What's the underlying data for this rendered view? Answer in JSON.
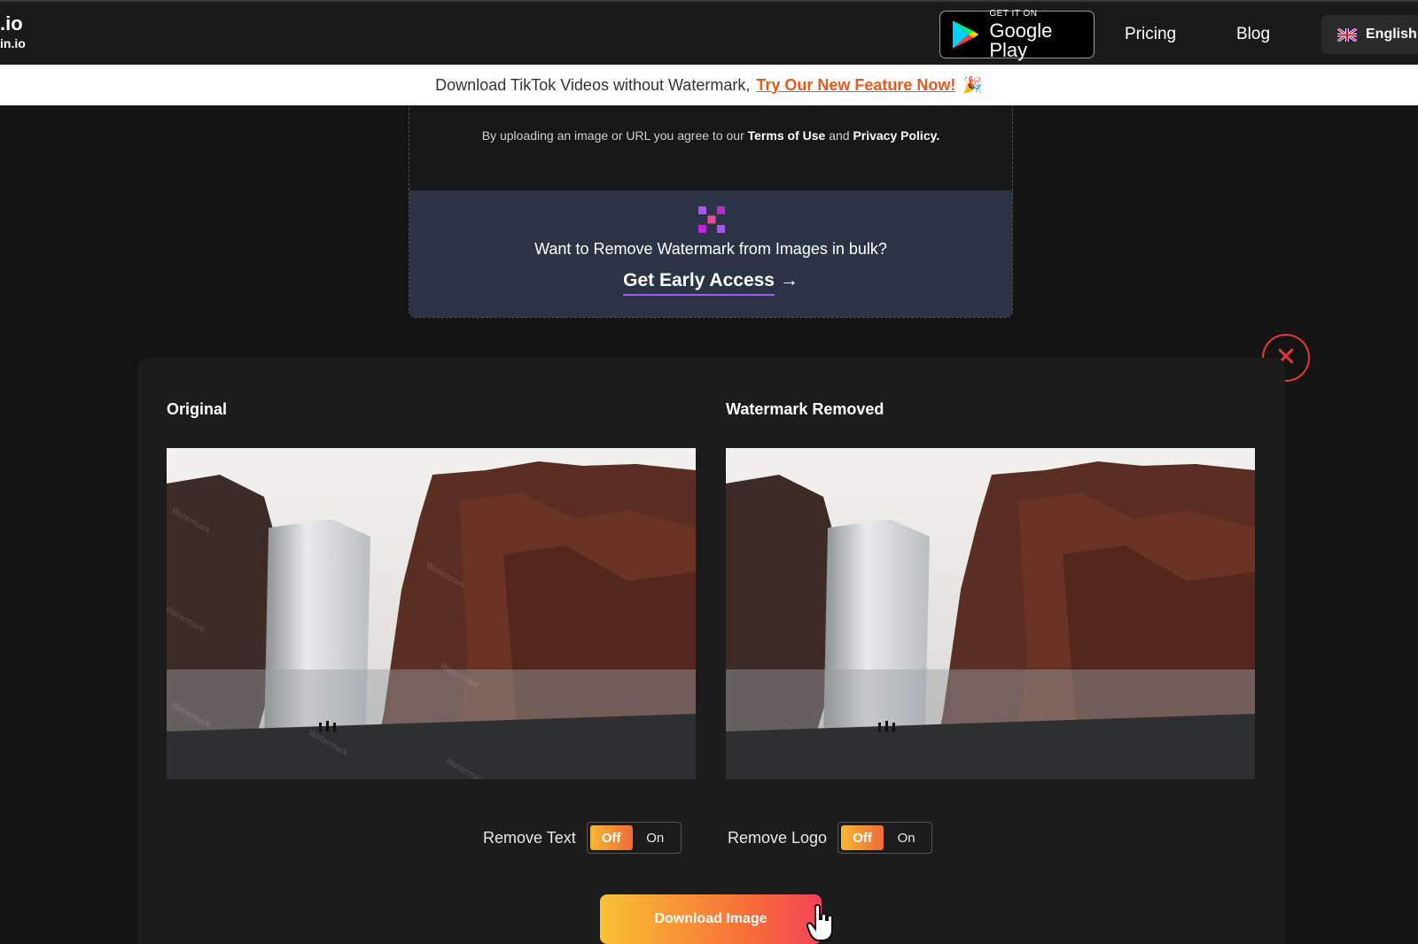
{
  "nav": {
    "logo_line1": ".io",
    "logo_line2": "in.io",
    "gplay_small": "GET IT ON",
    "gplay_big": "Google Play",
    "pricing": "Pricing",
    "blog": "Blog",
    "language": "English"
  },
  "banner": {
    "text": "Download TikTok Videos without Watermark,",
    "link": "Try Our New Feature Now!",
    "emoji": "🎉"
  },
  "upload": {
    "terms_prefix": "By uploading an image or URL you agree to our",
    "terms_link": "Terms of Use",
    "terms_and": "and",
    "privacy_link": "Privacy Policy.",
    "bulk_question": "Want to Remove Watermark from Images in bulk?",
    "early_access": "Get Early Access",
    "early_arrow": "→"
  },
  "close_symbol": "✕",
  "result": {
    "original_title": "Original",
    "removed_title": "Watermark Removed",
    "watermark_text": "Watermark",
    "remove_text_label": "Remove Text",
    "remove_logo_label": "Remove Logo",
    "toggle_off": "Off",
    "toggle_on": "On",
    "download_label": "Download Image"
  },
  "colors": {
    "accent_orange": "#f06a3a",
    "banner_link": "#e8591c",
    "close_red": "#e53935",
    "bulk_bg": "#2a3444",
    "early_underline": "#a855f7"
  }
}
